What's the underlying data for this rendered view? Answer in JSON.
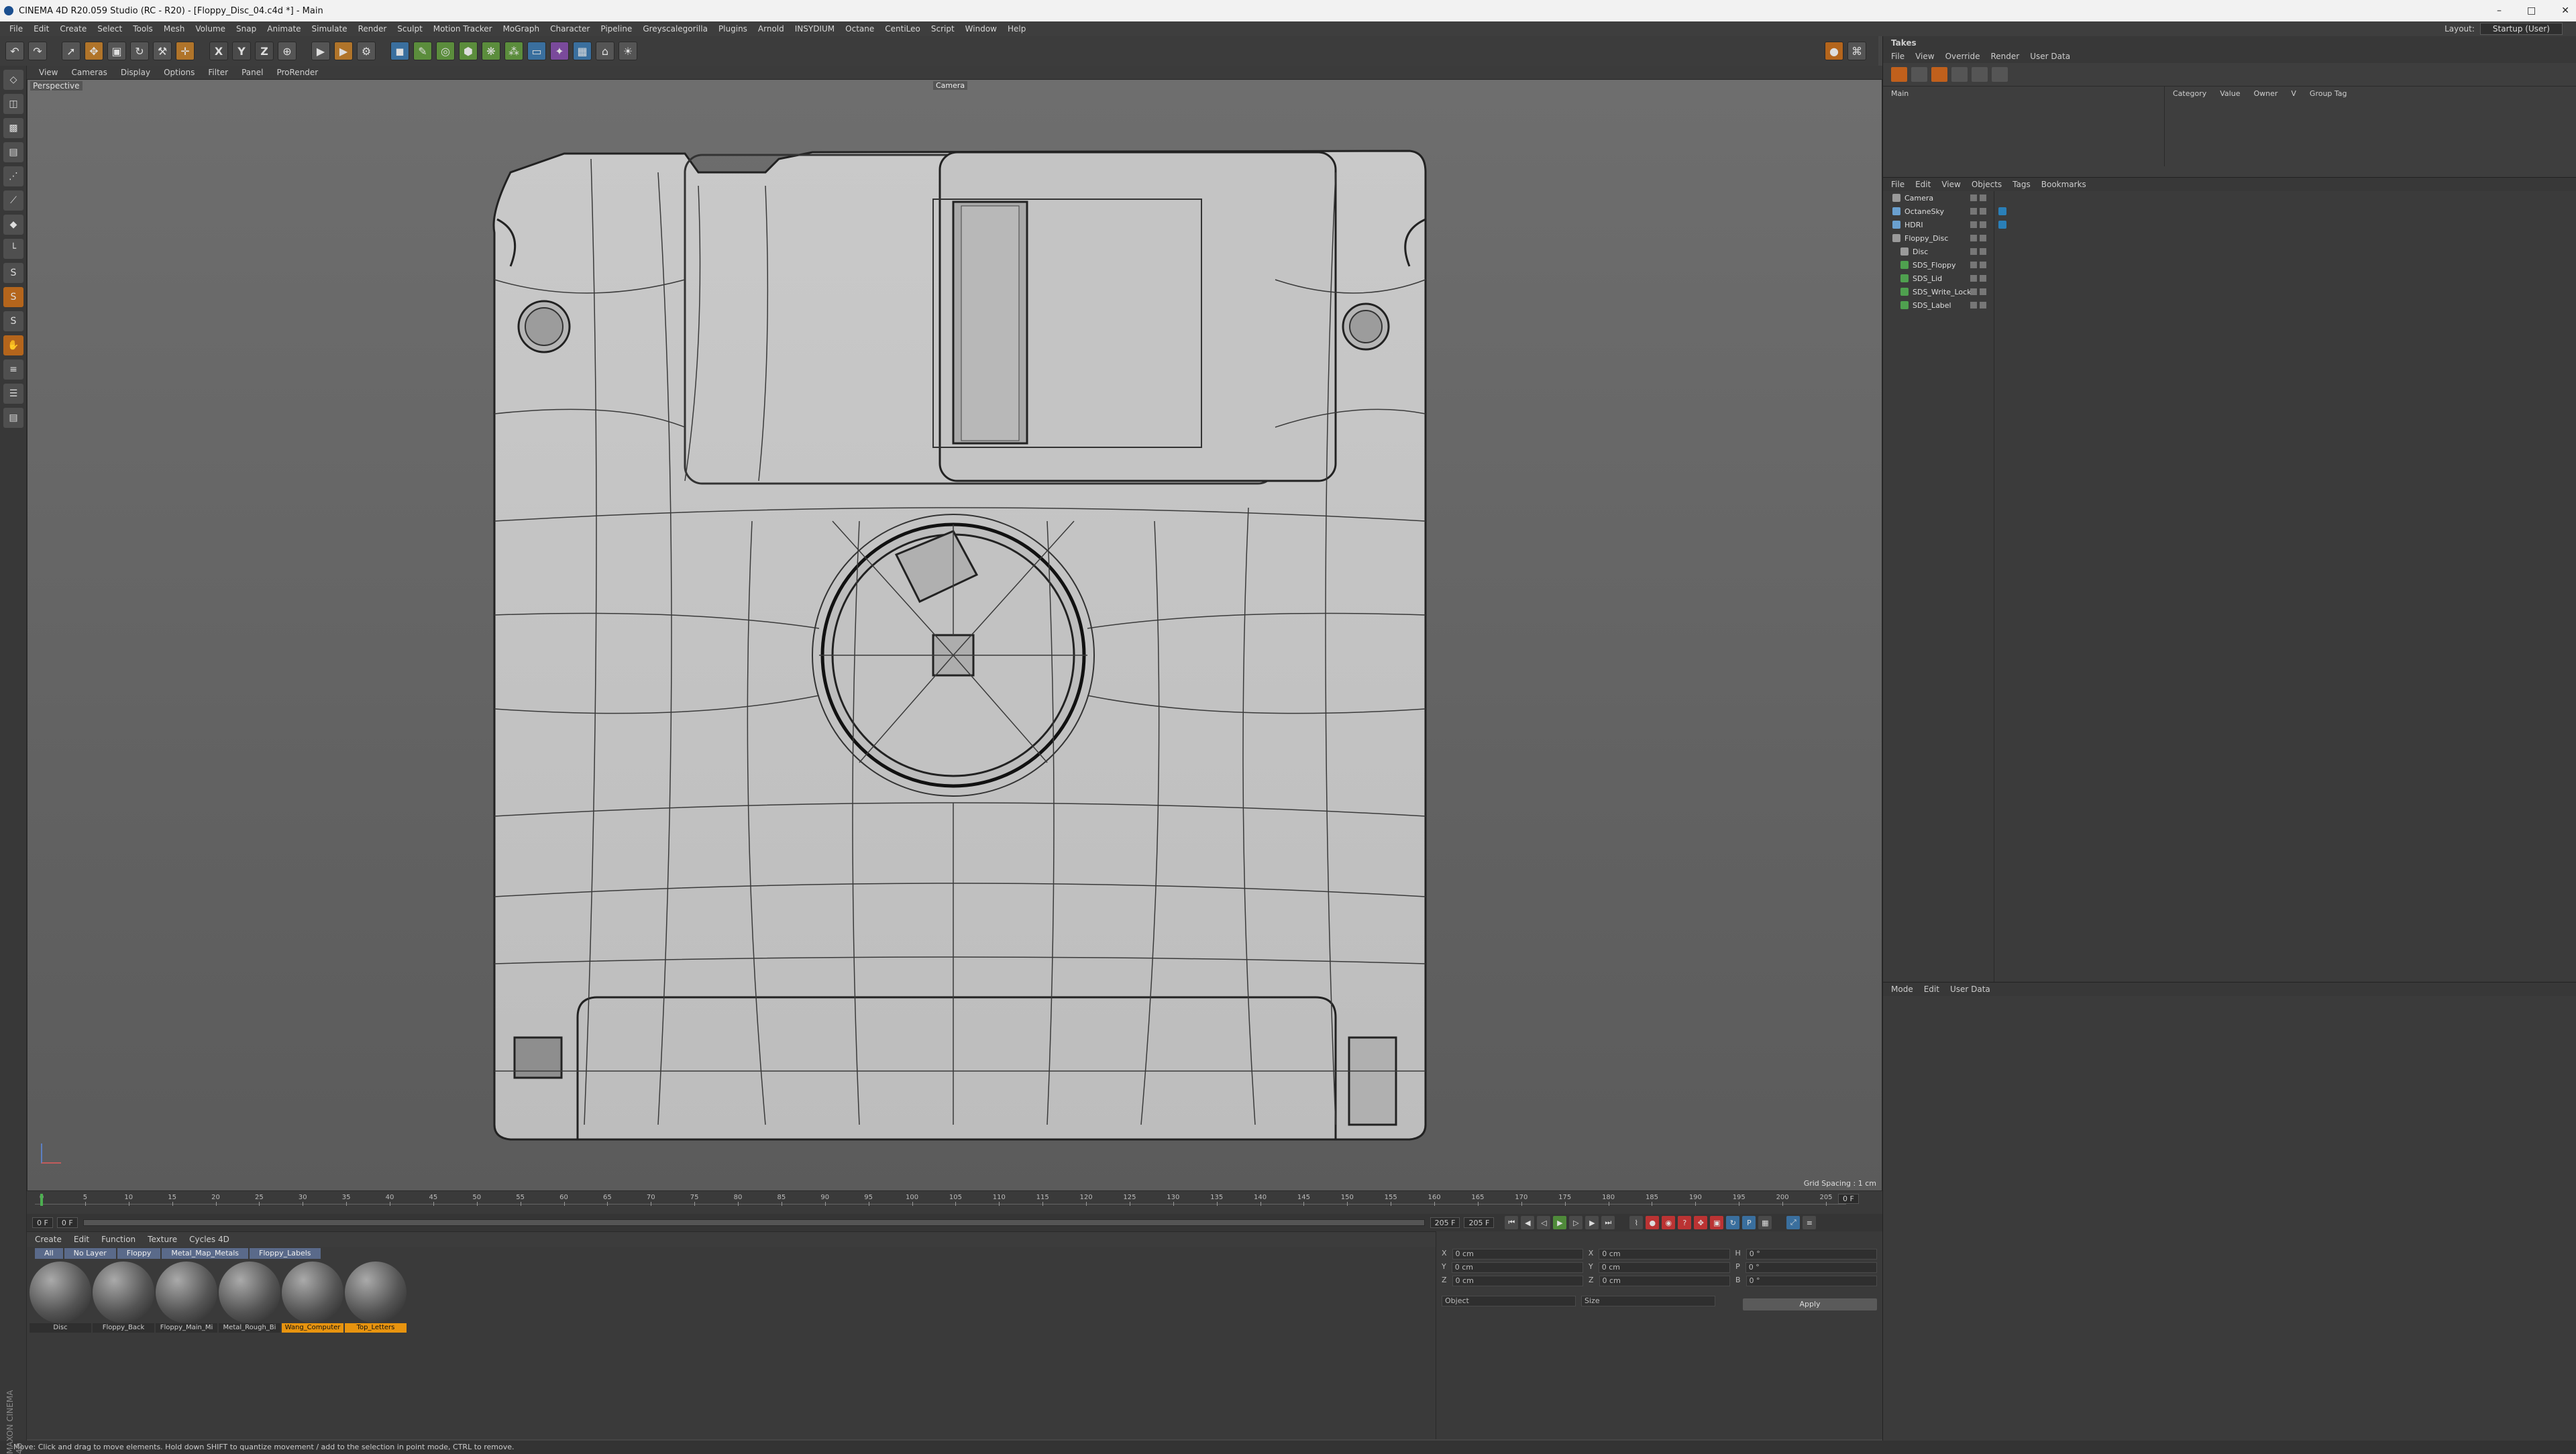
{
  "window": {
    "title": "CINEMA 4D R20.059 Studio (RC - R20) - [Floppy_Disc_04.c4d *] - Main",
    "controls": [
      "–",
      "□",
      "✕"
    ]
  },
  "menubar": [
    "File",
    "Edit",
    "Create",
    "Select",
    "Tools",
    "Mesh",
    "Volume",
    "Snap",
    "Animate",
    "Simulate",
    "Render",
    "Sculpt",
    "Motion Tracker",
    "MoGraph",
    "Character",
    "Pipeline",
    "Greyscalegorilla",
    "Plugins",
    "Arnold",
    "INSYDIUM",
    "Octane",
    "CentiLeo",
    "Script",
    "Window",
    "Help"
  ],
  "layout": {
    "label": "Layout:",
    "value": "Startup (User)"
  },
  "viewport": {
    "menu": [
      "View",
      "Cameras",
      "Display",
      "Options",
      "Filter",
      "Panel",
      "ProRender"
    ],
    "label": "Perspective",
    "camera": "Camera",
    "grid_spacing": "Grid Spacing : 1 cm"
  },
  "timeline": {
    "ticks": [
      "0",
      "5",
      "10",
      "15",
      "20",
      "25",
      "30",
      "35",
      "40",
      "45",
      "50",
      "55",
      "60",
      "65",
      "70",
      "75",
      "80",
      "85",
      "90",
      "95",
      "100",
      "105",
      "110",
      "115",
      "120",
      "125",
      "130",
      "135",
      "140",
      "145",
      "150",
      "155",
      "160",
      "165",
      "170",
      "175",
      "180",
      "185",
      "190",
      "195",
      "200",
      "205"
    ],
    "current_frame": "0 F",
    "start": "0 F",
    "min": "0 F",
    "end": "205 F",
    "max": "205 F"
  },
  "materials": {
    "menu": [
      "Create",
      "Edit",
      "Function",
      "Texture",
      "Cycles 4D"
    ],
    "filters": [
      "All",
      "No Layer",
      "Floppy",
      "Metal_Map_Metals",
      "Floppy_Labels"
    ],
    "items": [
      {
        "name": "Disc",
        "highlight": false
      },
      {
        "name": "Floppy_Back",
        "highlight": false
      },
      {
        "name": "Floppy_Main_Mi",
        "highlight": false
      },
      {
        "name": "Metal_Rough_Bi",
        "highlight": false
      },
      {
        "name": "Wang_Computer",
        "highlight": true
      },
      {
        "name": "Top_Letters",
        "highlight": true
      }
    ]
  },
  "coordinates": {
    "rows": [
      {
        "a": "X",
        "av": "0 cm",
        "b": "X",
        "bv": "0 cm",
        "c": "H",
        "cv": "0 °"
      },
      {
        "a": "Y",
        "av": "0 cm",
        "b": "Y",
        "bv": "0 cm",
        "c": "P",
        "cv": "0 °"
      },
      {
        "a": "Z",
        "av": "0 cm",
        "b": "Z",
        "bv": "0 cm",
        "c": "B",
        "cv": "0 °"
      }
    ],
    "mode1": "Object",
    "mode2": "Size",
    "apply": "Apply"
  },
  "takes": {
    "title": "Takes",
    "menu": [
      "File",
      "View",
      "Override",
      "Render",
      "User Data"
    ],
    "main_take": "Main",
    "columns": [
      "Category",
      "Value",
      "Owner",
      "V",
      "Group Tag"
    ]
  },
  "objects": {
    "menu": [
      "File",
      "Edit",
      "View",
      "Objects",
      "Tags",
      "Bookmarks"
    ],
    "items": [
      {
        "name": "Camera",
        "color": "#9a9a9a",
        "tag": false
      },
      {
        "name": "OctaneSky",
        "color": "#6aa0d0",
        "tag": true
      },
      {
        "name": "HDRI",
        "color": "#6aa0d0",
        "tag": true
      },
      {
        "name": "Floppy_Disc",
        "color": "#9a9a9a",
        "tag": false
      },
      {
        "name": "Disc",
        "color": "#9a9a9a",
        "tag": false
      },
      {
        "name": "SDS_Floppy",
        "color": "#4fa04f",
        "tag": false
      },
      {
        "name": "SDS_Lid",
        "color": "#4fa04f",
        "tag": false
      },
      {
        "name": "SDS_Write_Lock",
        "color": "#4fa04f",
        "tag": false
      },
      {
        "name": "SDS_Label",
        "color": "#4fa04f",
        "tag": false
      }
    ]
  },
  "attributes": {
    "menu": [
      "Mode",
      "Edit",
      "User Data"
    ]
  },
  "status": "Move: Click and drag to move elements. Hold down SHIFT to quantize movement / add to the selection in point mode, CTRL to remove.",
  "brand": "MAXON CINEMA 4D"
}
